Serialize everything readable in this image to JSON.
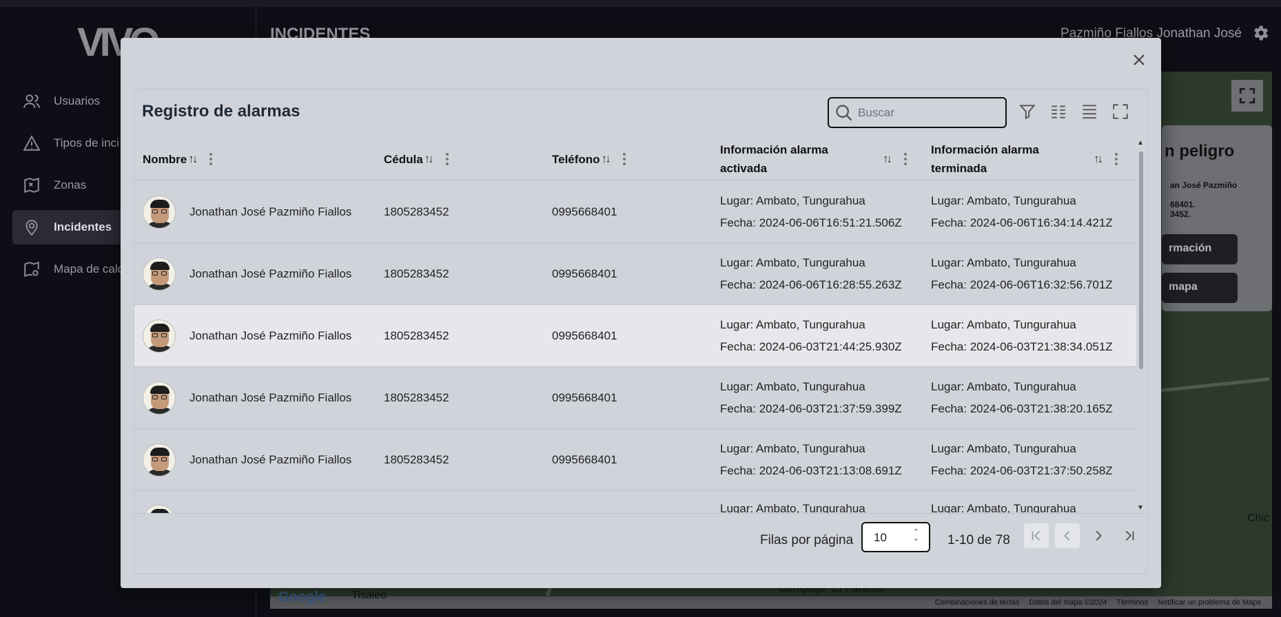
{
  "app": {
    "logo": "VIVO",
    "page_heading": "INCIDENTES",
    "user_name": "Pazmiño Fiallos Jonathan José",
    "nav": [
      {
        "label": "Usuarios",
        "icon": "users-icon",
        "active": false
      },
      {
        "label": "Tipos de inci",
        "icon": "warning-icon",
        "active": false
      },
      {
        "label": "Zonas",
        "icon": "map-zones-icon",
        "active": false
      },
      {
        "label": "Incidentes",
        "icon": "location-pin-icon",
        "active": true
      },
      {
        "label": "Mapa de calo",
        "icon": "heatmap-icon",
        "active": false
      }
    ],
    "danger_card": {
      "title": "n peligro",
      "line1": "an José Pazmiño",
      "line2": "68401.",
      "line3": "3452.",
      "button1": "rmación",
      "button2": "mapa"
    },
    "map": {
      "google": "Google",
      "place1": "Tisaleo",
      "place2": "Complejo \"El Paraíso\"",
      "edge_label": "Chic",
      "footer": [
        "Combinaciones de teclas",
        "Datos del mapa ©2024",
        "Términos",
        "Notificar un problema de Maps"
      ]
    }
  },
  "modal": {
    "title": "Registro de alarmas",
    "search_placeholder": "Buscar",
    "columns": {
      "nombre": "Nombre",
      "cedula": "Cédula",
      "telefono": "Teléfono",
      "activada": "Información alarma activada",
      "terminada": "Información alarma terminada"
    },
    "rows": [
      {
        "nombre": "Jonathan José Pazmiño Fiallos",
        "cedula": "1805283452",
        "telefono": "0995668401",
        "act_lugar": "Lugar: Ambato, Tungurahua",
        "act_fecha": "Fecha: 2024-06-06T16:51:21.506Z",
        "ter_lugar": "Lugar: Ambato, Tungurahua",
        "ter_fecha": "Fecha: 2024-06-06T16:34:14.421Z"
      },
      {
        "nombre": "Jonathan José Pazmiño Fiallos",
        "cedula": "1805283452",
        "telefono": "0995668401",
        "act_lugar": "Lugar: Ambato, Tungurahua",
        "act_fecha": "Fecha: 2024-06-06T16:28:55.263Z",
        "ter_lugar": "Lugar: Ambato, Tungurahua",
        "ter_fecha": "Fecha: 2024-06-06T16:32:56.701Z"
      },
      {
        "nombre": "Jonathan José Pazmiño Fiallos",
        "cedula": "1805283452",
        "telefono": "0995668401",
        "act_lugar": "Lugar: Ambato, Tungurahua",
        "act_fecha": "Fecha: 2024-06-03T21:44:25.930Z",
        "ter_lugar": "Lugar: Ambato, Tungurahua",
        "ter_fecha": "Fecha: 2024-06-03T21:38:34.051Z"
      },
      {
        "nombre": "Jonathan José Pazmiño Fiallos",
        "cedula": "1805283452",
        "telefono": "0995668401",
        "act_lugar": "Lugar: Ambato, Tungurahua",
        "act_fecha": "Fecha: 2024-06-03T21:37:59.399Z",
        "ter_lugar": "Lugar: Ambato, Tungurahua",
        "ter_fecha": "Fecha: 2024-06-03T21:38:20.165Z"
      },
      {
        "nombre": "Jonathan José Pazmiño Fiallos",
        "cedula": "1805283452",
        "telefono": "0995668401",
        "act_lugar": "Lugar: Ambato, Tungurahua",
        "act_fecha": "Fecha: 2024-06-03T21:13:08.691Z",
        "ter_lugar": "Lugar: Ambato, Tungurahua",
        "ter_fecha": "Fecha: 2024-06-03T21:37:50.258Z"
      },
      {
        "nombre": "",
        "cedula": "",
        "telefono": "",
        "act_lugar": "Lugar: Ambato, Tungurahua",
        "act_fecha": "",
        "ter_lugar": "Lugar: Ambato, Tungurahua",
        "ter_fecha": ""
      }
    ],
    "footer": {
      "rows_per_page_label": "Filas por página",
      "rows_per_page_value": "10",
      "range": "1-10 de 78"
    }
  }
}
